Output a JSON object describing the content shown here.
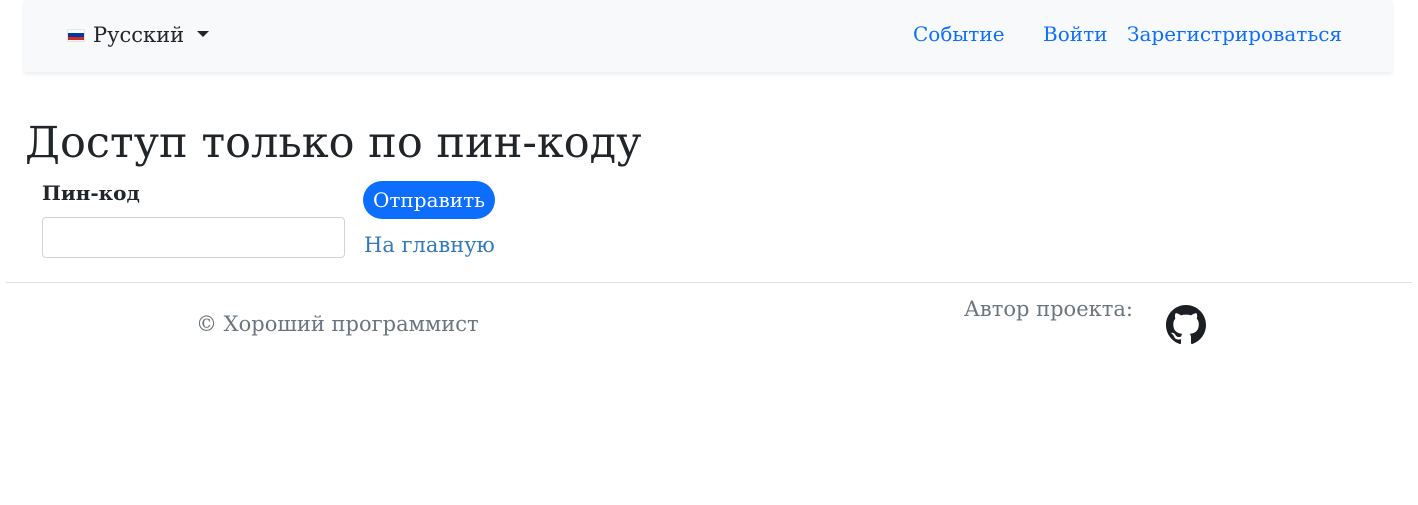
{
  "navbar": {
    "language": {
      "label": "Русский",
      "flag_icon": "russia-flag-icon"
    },
    "links": {
      "event": "Событие",
      "login": "Войти",
      "register": "Зарегистрироваться"
    },
    "link_color": "#0d6efd",
    "background": "#f8f9fa"
  },
  "main": {
    "title": "Доступ только по пин-коду",
    "pin_label": "Пин-код",
    "pin_value": "",
    "submit_label": "Отправить",
    "home_link": "На главную",
    "accent_color": "#0d6efd"
  },
  "footer": {
    "copyright": "© Хороший программист",
    "author_label": "Автор проекта:",
    "github_icon": "github-icon"
  }
}
